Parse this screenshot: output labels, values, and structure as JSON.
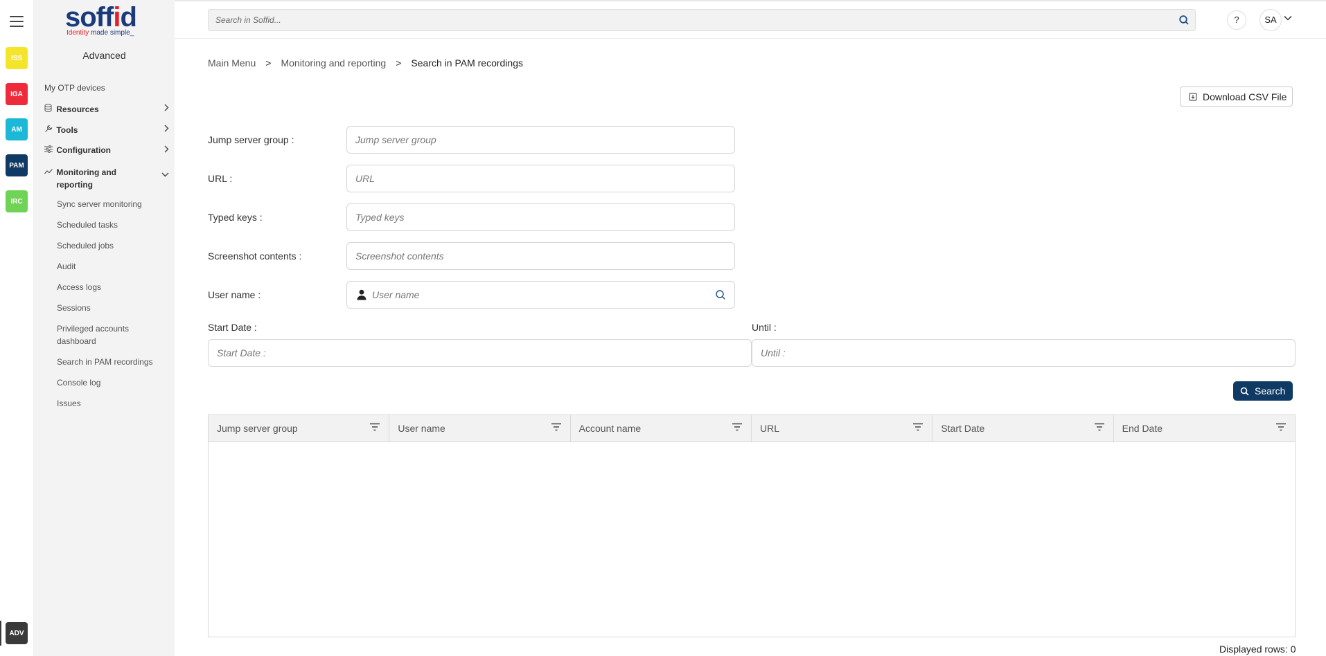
{
  "app_rail": {
    "tiles": [
      {
        "label": "ISS",
        "bg": "#f5e52a",
        "fg": "#ffffff"
      },
      {
        "label": "IGA",
        "bg": "#ef2a3a",
        "fg": "#ffffff"
      },
      {
        "label": "AM",
        "bg": "#1cb8d8",
        "fg": "#ffffff"
      },
      {
        "label": "PAM",
        "bg": "#0e3a63",
        "fg": "#ffffff"
      },
      {
        "label": "IRC",
        "bg": "#6fd455",
        "fg": "#ffffff"
      }
    ],
    "bottom_tile": {
      "label": "ADV",
      "bg": "#3a3a3a",
      "fg": "#ffffff"
    }
  },
  "logo": {
    "word": "soffid",
    "tagline_red": "Identity",
    "tagline_blue": "made simple_"
  },
  "sidebar": {
    "title": "Advanced",
    "items": [
      {
        "label": "My OTP devices"
      },
      {
        "label": "Resources",
        "icon": "database-icon"
      },
      {
        "label": "Tools",
        "icon": "wrench-icon"
      },
      {
        "label": "Configuration",
        "icon": "sliders-icon"
      },
      {
        "label": "Monitoring and reporting",
        "icon": "chart-line-icon"
      }
    ],
    "subitems": [
      "Sync server monitoring",
      "Scheduled tasks",
      "Scheduled jobs",
      "Audit",
      "Access logs",
      "Sessions",
      "Privileged accounts dashboard",
      "Search in PAM recordings",
      "Console log",
      "Issues"
    ]
  },
  "header": {
    "search_placeholder": "Search in Soffid...",
    "help_label": "?",
    "avatar_initials": "SA"
  },
  "breadcrumb": {
    "items": [
      "Main Menu",
      "Monitoring and reporting",
      "Search in PAM recordings"
    ],
    "separator": ">"
  },
  "actions": {
    "download_csv_label": "Download CSV File",
    "search_label": "Search"
  },
  "form": {
    "jump_server_group": {
      "label": "Jump server group :",
      "placeholder": "Jump server group"
    },
    "url": {
      "label": "URL :",
      "placeholder": "URL"
    },
    "typed_keys": {
      "label": "Typed keys :",
      "placeholder": "Typed keys"
    },
    "screenshot_contents": {
      "label": "Screenshot contents :",
      "placeholder": "Screenshot contents"
    },
    "user_name": {
      "label": "User name :",
      "placeholder": "User name"
    },
    "start_date": {
      "label": "Start Date :",
      "placeholder": "Start Date :"
    },
    "until": {
      "label": "Until :",
      "placeholder": "Until :"
    }
  },
  "table": {
    "columns": [
      "Jump server group",
      "User name",
      "Account name",
      "URL",
      "Start Date",
      "End Date"
    ],
    "rows": [],
    "footer": "Displayed rows: 0"
  },
  "colors": {
    "primary": "#0e3a63",
    "sidebar_bg": "#f3f3f3",
    "brand_red": "#e5202b",
    "brand_blue": "#1a3a7a"
  }
}
